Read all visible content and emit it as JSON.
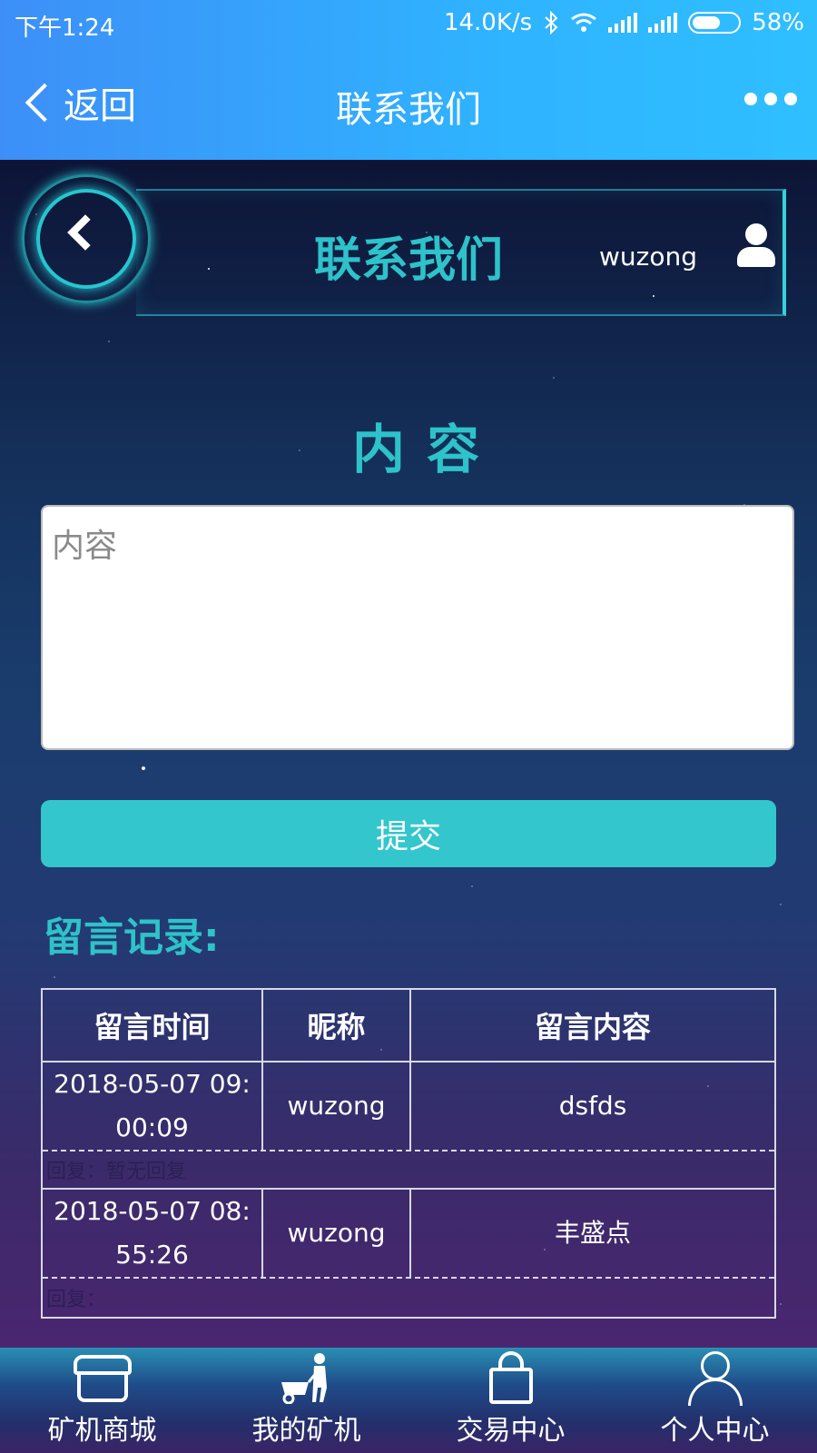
{
  "status": {
    "time": "下午1:24",
    "speed": "14.0K/s",
    "battery": "58%"
  },
  "nav": {
    "back_label": "返回",
    "title": "联系我们"
  },
  "header": {
    "title": "联系我们",
    "username": "wuzong"
  },
  "form": {
    "section_title": "内容",
    "placeholder": "内容",
    "value": "",
    "submit_label": "提交"
  },
  "records": {
    "title": "留言记录:",
    "columns": [
      "留言时间",
      "昵称",
      "留言内容"
    ],
    "rows": [
      {
        "time": "2018-05-07 09:00:09",
        "nickname": "wuzong",
        "content": "dsfds",
        "reply": "回复：暂无回复"
      },
      {
        "time": "2018-05-07 08:55:26",
        "nickname": "wuzong",
        "content": "丰盛点",
        "reply": "回复："
      }
    ]
  },
  "tabbar": {
    "items": [
      {
        "label": "矿机商城",
        "icon": "shop-icon"
      },
      {
        "label": "我的矿机",
        "icon": "miner-cart-icon"
      },
      {
        "label": "交易中心",
        "icon": "shopping-bag-icon"
      },
      {
        "label": "个人中心",
        "icon": "person-icon"
      }
    ]
  },
  "colors": {
    "accent": "#33c6cd",
    "appbar": "#2fb3ff"
  }
}
